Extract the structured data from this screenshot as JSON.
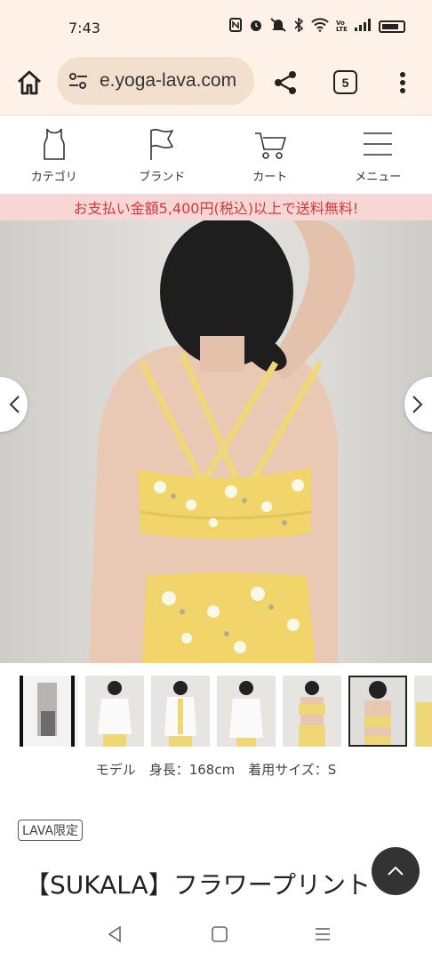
{
  "status_bar": {
    "time": "7:43",
    "icons": [
      "nfc-icon",
      "alarm-icon",
      "mute-icon",
      "bluetooth-icon",
      "wifi-icon",
      "volte-icon",
      "signal-icon",
      "battery-icon"
    ],
    "volte_label": "Vo LTE"
  },
  "browser": {
    "url": "e.yoga-lava.com",
    "tab_count": "5"
  },
  "site_nav": {
    "items": [
      {
        "label": "カテゴリ",
        "icon": "tank-top-icon"
      },
      {
        "label": "ブランド",
        "icon": "flag-icon"
      },
      {
        "label": "カート",
        "icon": "cart-icon"
      },
      {
        "label": "メニュー",
        "icon": "menu-icon"
      }
    ]
  },
  "promo": {
    "text": "お支払い金額5,400円(税込)以上で送料無料!",
    "color": "#d23a3a"
  },
  "gallery": {
    "thumbnail_count": 7,
    "selected_index": 5
  },
  "caption": "モデル　身長：168cm　着用サイズ：S",
  "badge": "LAVA限定",
  "product_title": "【SUKALA】フラワープリント"
}
